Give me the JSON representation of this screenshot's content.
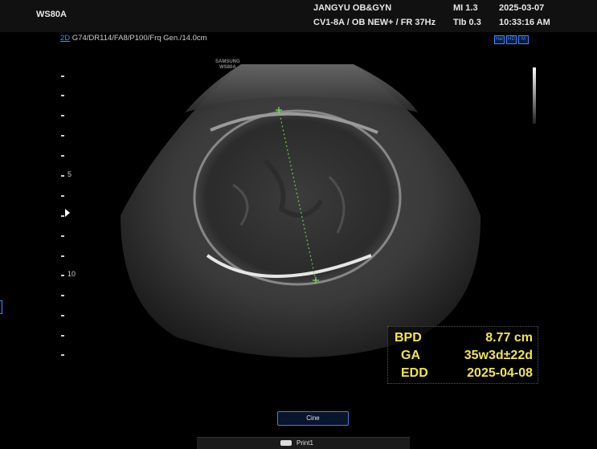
{
  "header": {
    "device": "WS80A",
    "hospital": "JANGYU OB&GYN",
    "probe_preset": "CV1-8A / OB NEW+ / FR 37Hz",
    "mi": "MI  1.3",
    "tib": "TIb 0.3",
    "date": "2025-03-07",
    "time": "10:33:16 AM"
  },
  "params": {
    "mode": "2D",
    "settings": " G74/DR114/FA8/P100/Frq Gen./14.0cm"
  },
  "status_icons": [
    "Har",
    "HD",
    "M"
  ],
  "watermark": [
    "SAMSUNG",
    "WS80A"
  ],
  "depth_scale": {
    "labels": [
      "5",
      "10"
    ]
  },
  "measurements": [
    {
      "label": "BPD",
      "value": "8.77 cm"
    },
    {
      "label": "GA",
      "value": "35w3d±22d"
    },
    {
      "label": "EDD",
      "value": "2025-04-08"
    }
  ],
  "buttons": {
    "cine": "Cine",
    "print": "Print1"
  }
}
